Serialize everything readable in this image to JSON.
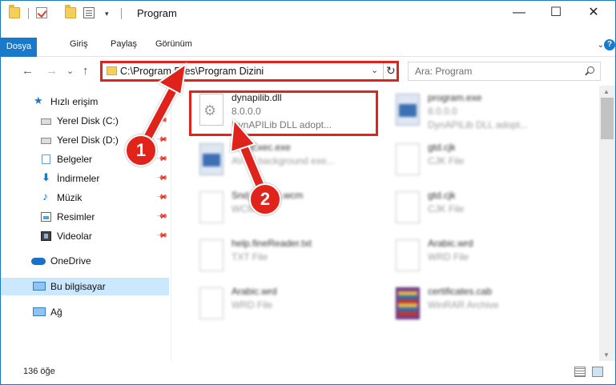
{
  "window": {
    "title": "Program",
    "controls": {
      "minimize": "—",
      "maximize": "☐",
      "close": "✕"
    }
  },
  "ribbon": {
    "tabs": [
      "Dosya",
      "Giriş",
      "Paylaş",
      "Görünüm"
    ],
    "expand_glyph": "⌄",
    "help_glyph": "?"
  },
  "nav": {
    "back_glyph": "←",
    "forward_glyph": "→",
    "recent_glyph": "⌄",
    "up_glyph": "↑",
    "address": "C:\\Program Files\\Program Dizini",
    "address_chevron": "⌄",
    "refresh_glyph": "↻",
    "search_placeholder": "Ara: Program"
  },
  "sidebar": {
    "quick_access": "Hızlı erişim",
    "items": [
      {
        "label": "Yerel Disk (C:)",
        "icon": "drive-icon",
        "pinned": true
      },
      {
        "label": "Yerel Disk (D:)",
        "icon": "drive-icon",
        "pinned": true
      },
      {
        "label": "Belgeler",
        "icon": "documents-icon",
        "pinned": true
      },
      {
        "label": "İndirmeler",
        "icon": "downloads-icon",
        "pinned": true
      },
      {
        "label": "Müzik",
        "icon": "music-icon",
        "pinned": true
      },
      {
        "label": "Resimler",
        "icon": "pictures-icon",
        "pinned": true
      },
      {
        "label": "Videolar",
        "icon": "videos-icon",
        "pinned": true
      }
    ],
    "onedrive": "OneDrive",
    "this_pc": "Bu bilgisayar",
    "network": "Ağ",
    "pin_glyph": "📌",
    "star_glyph": "★",
    "download_glyph": "⬇",
    "music_glyph": "♪"
  },
  "files": [
    {
      "name": "dynapilib.dll",
      "line2": "8.0.0.0",
      "line3": "DynAPILib DLL adopt...",
      "icon": "dll-gear-icon",
      "highlighted": true
    },
    {
      "name": "program.exe",
      "line2": "8.0.0.0",
      "line3": "DynAPILib DLL adopt...",
      "icon": "exe-icon",
      "blurred": true
    },
    {
      "name": "WebExec.exe",
      "line2": "AVX7 background exe...",
      "line3": "",
      "icon": "exe-icon",
      "blurred": true
    },
    {
      "name": "gtd.cjk",
      "line2": "CJK File",
      "line3": "",
      "icon": "file-icon",
      "blurred": true
    },
    {
      "name": "Snd_____6.wcm",
      "line2": "WCM File",
      "line3": "",
      "icon": "file-icon",
      "blurred": true
    },
    {
      "name": "gtd.cjk",
      "line2": "CJK File",
      "line3": "",
      "icon": "file-icon",
      "blurred": true
    },
    {
      "name": "help.fineReader.txt",
      "line2": "TXT File",
      "line3": "",
      "icon": "file-icon",
      "blurred": true
    },
    {
      "name": "Arabic.wrd",
      "line2": "WRD File",
      "line3": "",
      "icon": "file-icon",
      "blurred": true
    },
    {
      "name": "Arabic.wrd",
      "line2": "WRD File",
      "line3": "",
      "icon": "file-icon",
      "blurred": true
    },
    {
      "name": "certificates.cab",
      "line2": "WinRAR Archive",
      "line3": "",
      "icon": "winrar-icon",
      "blurred": true
    }
  ],
  "status": {
    "item_count": "136 öğe"
  },
  "annotations": {
    "badge_1": "1",
    "badge_2": "2",
    "color": "#e0241b"
  }
}
